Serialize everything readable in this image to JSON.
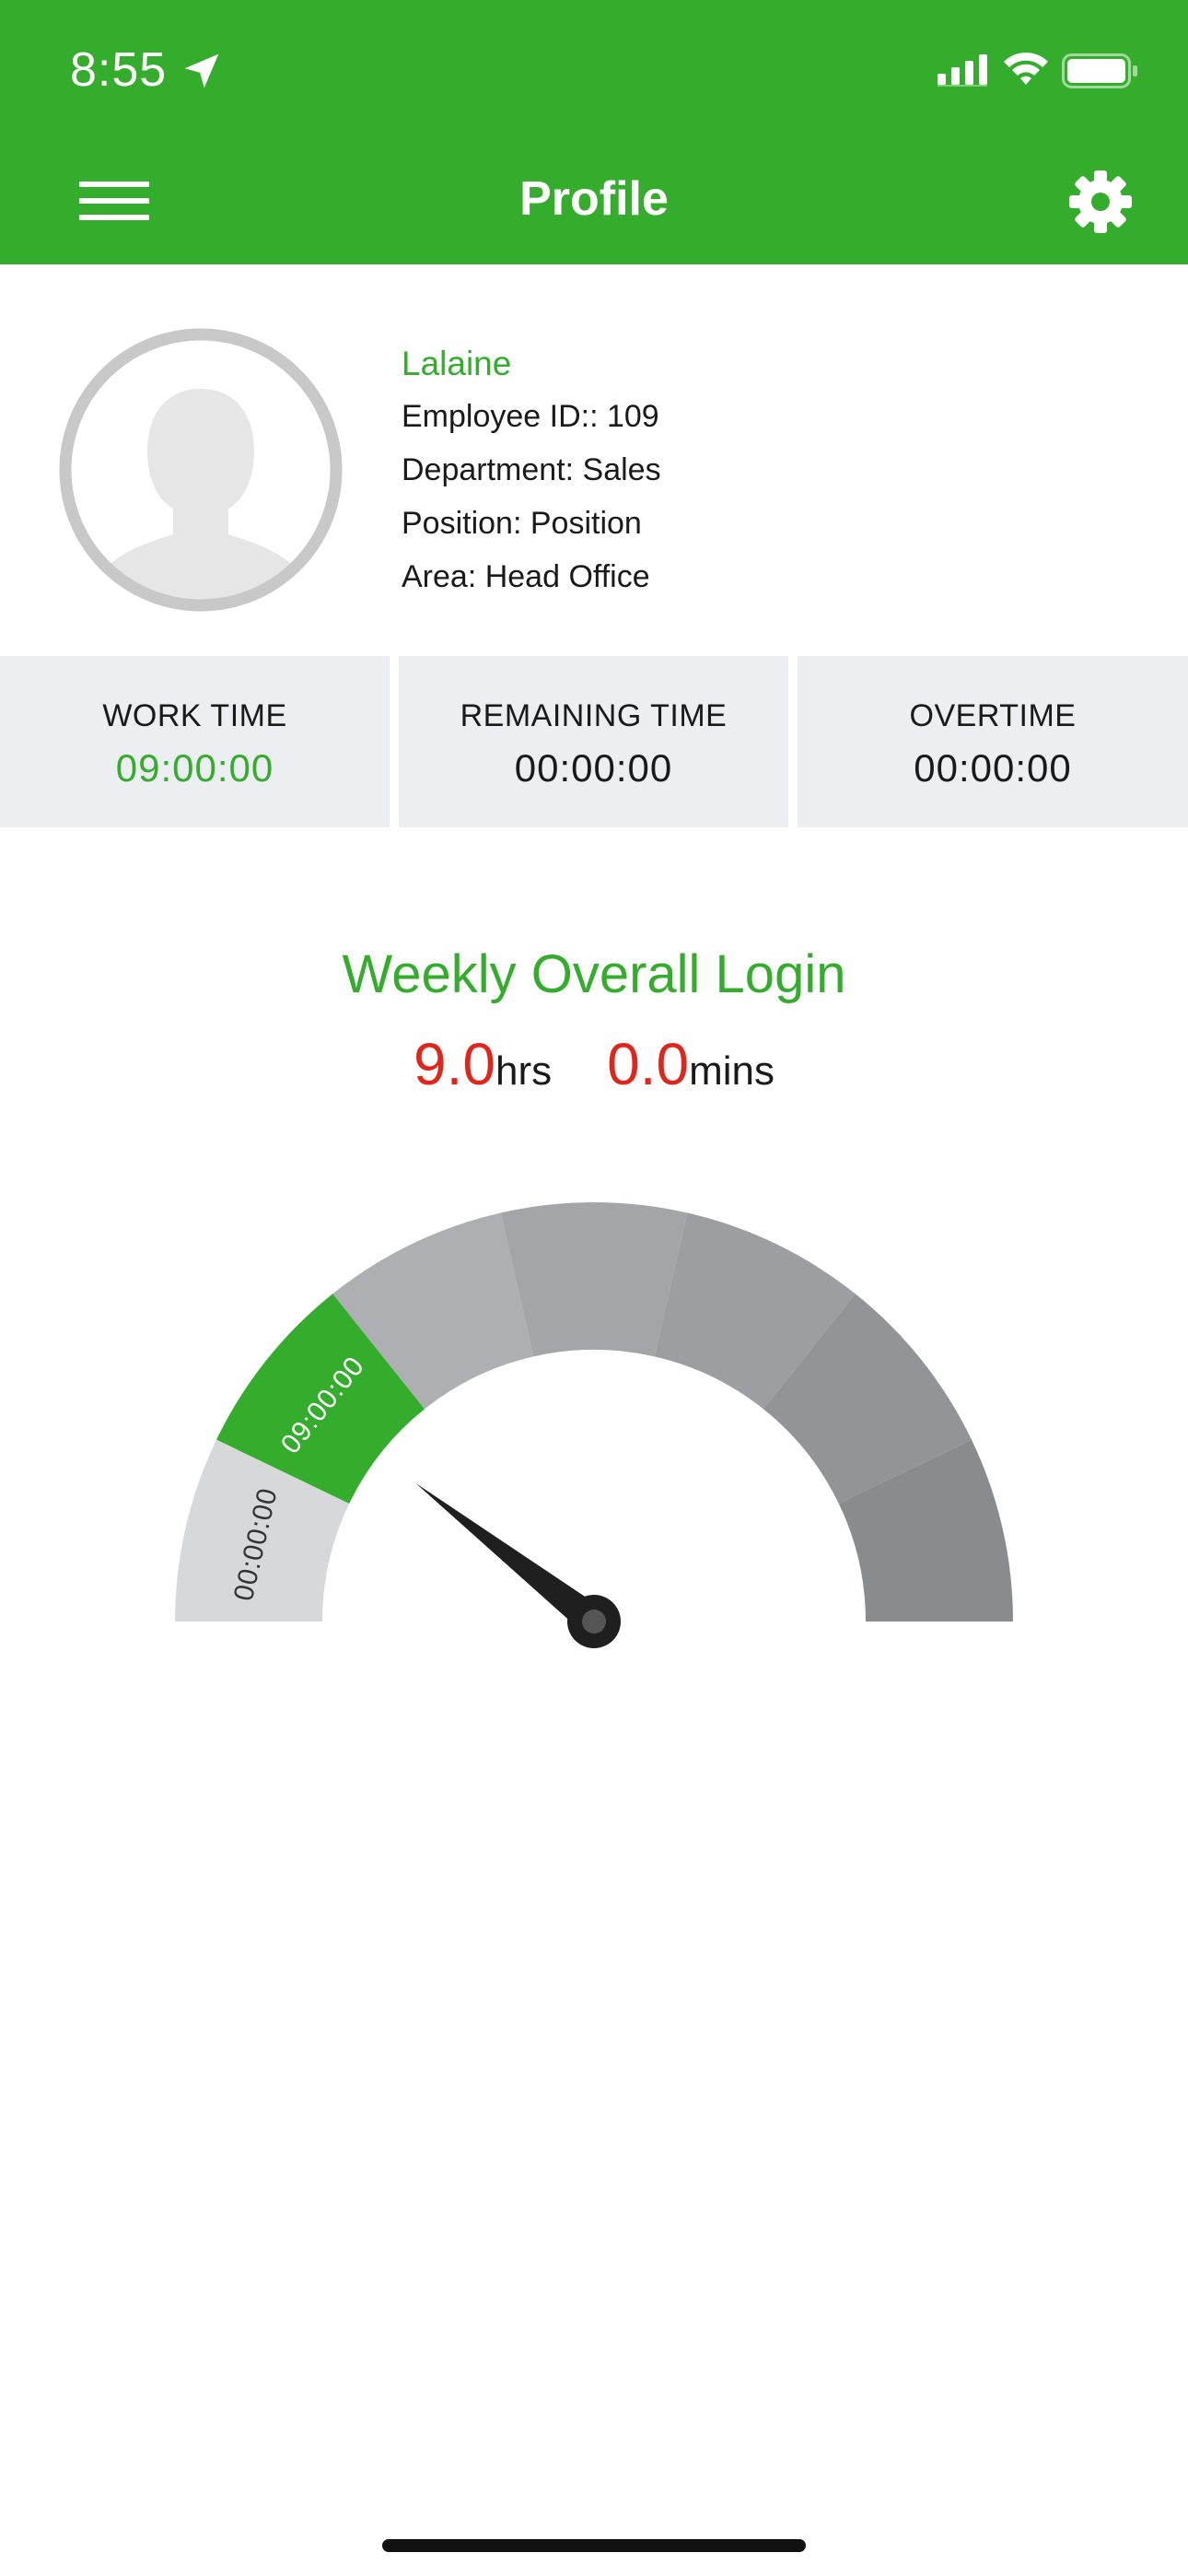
{
  "status_bar": {
    "time": "8:55",
    "icons": [
      "location-arrow-icon",
      "cellular-signal-icon",
      "wifi-icon",
      "battery-icon"
    ]
  },
  "header": {
    "title": "Profile",
    "left_icon": "hamburger-menu-icon",
    "right_icon": "gear-icon"
  },
  "profile": {
    "avatar_icon": "person-silhouette-icon",
    "name": "Lalaine",
    "employee_id": "Employee ID:: 109",
    "department": "Department: Sales",
    "position": "Position: Position",
    "area": "Area: Head Office"
  },
  "stats": [
    {
      "label": "WORK TIME",
      "value": "09:00:00"
    },
    {
      "label": "REMAINING TIME",
      "value": "00:00:00"
    },
    {
      "label": "OVERTIME",
      "value": "00:00:00"
    }
  ],
  "weekly": {
    "title": "Weekly Overall Login",
    "hours_value": "9.0",
    "hours_unit": "hrs",
    "mins_value": "0.0",
    "mins_unit": "mins"
  },
  "gauge": {
    "segments": [
      {
        "label": "00:00:00",
        "color": "#D7D8DA"
      },
      {
        "label": "09:00:00",
        "color": "#34AC2C"
      },
      {
        "label": "",
        "color": "#AEAFB2"
      },
      {
        "label": "",
        "color": "#A4A5A8"
      },
      {
        "label": "",
        "color": "#9D9EA1"
      },
      {
        "label": "",
        "color": "#939497"
      },
      {
        "label": "",
        "color": "#8A8B8D"
      }
    ],
    "needle_fraction": 0.21
  },
  "colors": {
    "brand_green": "#34AC2C",
    "accent_red": "#E1251B",
    "card_bg": "#ECEEF2"
  }
}
